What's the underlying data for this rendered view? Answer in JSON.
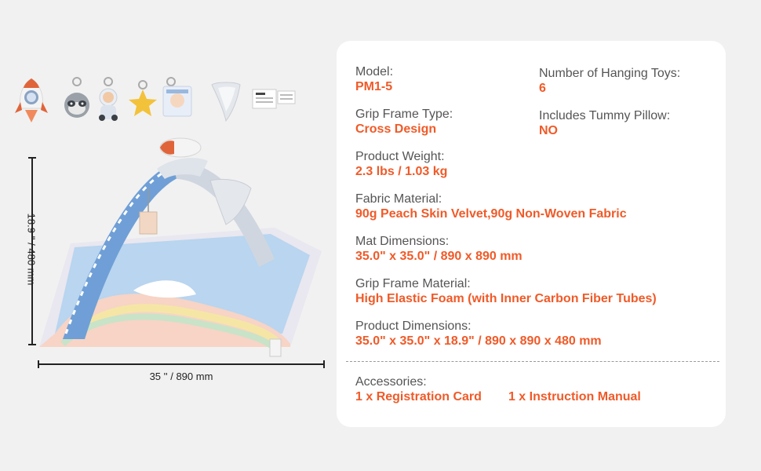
{
  "dimensions": {
    "height_label": "18.9 '' / 480 mm",
    "width_label": "35 '' / 890 mm"
  },
  "toys": [
    "rocket-toy",
    "raccoon-toy",
    "astronaut-toy",
    "star-toy",
    "cloth-book-toy",
    "moon-toy",
    "instruction-manual"
  ],
  "specs": {
    "model": {
      "label": "Model:",
      "value": "PM1-5"
    },
    "hanging_toys": {
      "label": "Number of Hanging Toys:",
      "value": "6"
    },
    "grip_frame_type": {
      "label": "Grip Frame Type:",
      "value": "Cross Design"
    },
    "tummy_pillow": {
      "label": "Includes Tummy Pillow:",
      "value": "NO"
    },
    "weight": {
      "label": "Product Weight:",
      "value": "2.3 lbs / 1.03 kg"
    },
    "fabric": {
      "label": "Fabric Material:",
      "value": "90g Peach Skin Velvet,90g Non-Woven Fabric"
    },
    "mat_dimensions": {
      "label": "Mat Dimensions:",
      "value": "35.0\" x 35.0\" / 890 x 890 mm"
    },
    "grip_frame_material": {
      "label": "Grip Frame Material:",
      "value": "High Elastic Foam (with Inner Carbon Fiber Tubes)"
    },
    "product_dimensions": {
      "label": "Product Dimensions:",
      "value": "35.0\" x 35.0\" x 18.9\" / 890 x 890 x 480 mm"
    },
    "accessories": {
      "label": "Accessories:",
      "items": [
        "1 x Registration Card",
        "1 x Instruction Manual"
      ]
    }
  },
  "colors": {
    "accent": "#f05a28",
    "label": "#555555",
    "card": "#ffffff",
    "background": "#f1f1f1"
  }
}
